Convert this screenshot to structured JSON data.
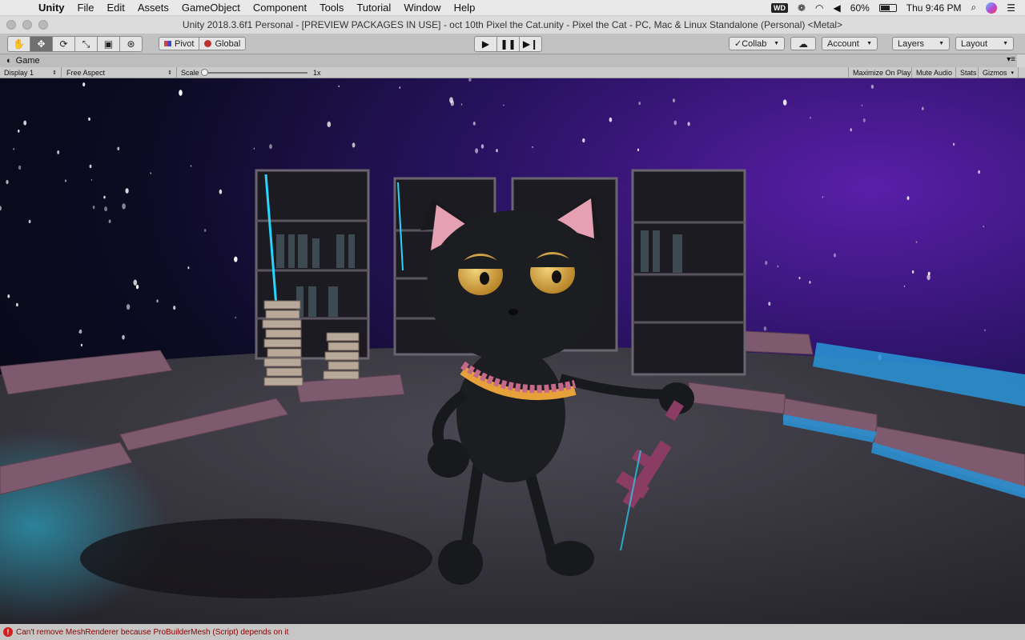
{
  "menubar": {
    "app_name": "Unity",
    "items": [
      "File",
      "Edit",
      "Assets",
      "GameObject",
      "Component",
      "Tools",
      "Tutorial",
      "Window",
      "Help"
    ],
    "status": {
      "wd_badge": "WD",
      "battery_percent": "60%",
      "battery_level": 0.6,
      "clock": "Thu 9:46 PM"
    }
  },
  "window": {
    "title": "Unity 2018.3.6f1 Personal - [PREVIEW PACKAGES IN USE] - oct 10th Pixel the Cat.unity - Pixel the Cat - PC, Mac & Linux Standalone (Personal) <Metal>"
  },
  "toolbar": {
    "transform_tools": [
      {
        "name": "hand-tool-button",
        "glyph": "✋"
      },
      {
        "name": "move-tool-button",
        "glyph": "✥"
      },
      {
        "name": "rotate-tool-button",
        "glyph": "⟳"
      },
      {
        "name": "scale-tool-button",
        "glyph": "⤡"
      },
      {
        "name": "rect-tool-button",
        "glyph": "▣"
      },
      {
        "name": "transform-tool-button",
        "glyph": "⊛"
      }
    ],
    "active_tool": 1,
    "pivot_label": "Pivot",
    "global_label": "Global",
    "play_glyph": "▶",
    "pause_glyph": "❚❚",
    "step_glyph": "▶❙",
    "collab_label": "✓Collab",
    "cloud_glyph": "☁",
    "account_label": "Account",
    "layers_label": "Layers",
    "layout_label": "Layout"
  },
  "game_tab": {
    "label": "Game",
    "display_label": "Display 1",
    "aspect_label": "Free Aspect",
    "scale_label": "Scale",
    "scale_value": "1x",
    "maximize_label": "Maximize On Play",
    "mute_label": "Mute Audio",
    "stats_label": "Stats",
    "gizmos_label": "Gizmos"
  },
  "status": {
    "message": "Can't remove MeshRenderer because ProBuilderMesh (Script) depends on it"
  },
  "colors": {
    "sky_purple": "#5a1ea8",
    "floor": "#3a3842",
    "wall_mauve": "#7d5a6e",
    "glow_cyan": "#27d6ff",
    "cat_body": "#18191c",
    "cat_ear_inner": "#e6a0b4",
    "cat_eye": "#d8a845",
    "error_red": "#d41f1f"
  }
}
